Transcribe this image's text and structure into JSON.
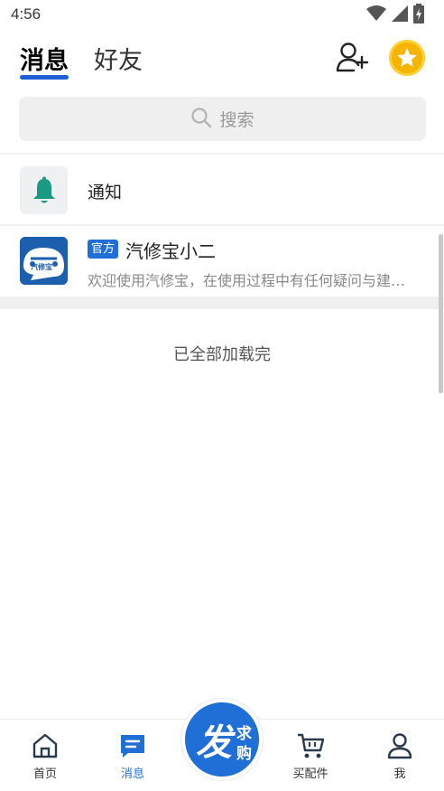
{
  "status_bar": {
    "time": "4:56",
    "icons": [
      "wifi-icon",
      "signal-icon",
      "battery-icon"
    ]
  },
  "header": {
    "tabs": [
      {
        "label": "消息",
        "active": true
      },
      {
        "label": "好友",
        "active": false
      }
    ],
    "icons": [
      "add-friend-icon",
      "coin-star-icon"
    ]
  },
  "search": {
    "placeholder": "搜索",
    "icon": "search-icon"
  },
  "notice": {
    "label": "通知",
    "icon": "bell-icon"
  },
  "chat_list": [
    {
      "badge": "官方",
      "name": "汽修宝小二",
      "preview": "欢迎使用汽修宝，在使用过程中有任何疑问与建…",
      "avatar_text": "汽修宝"
    }
  ],
  "footer_text": "已全部加载完",
  "bottom_nav": {
    "items": [
      {
        "label": "首页",
        "icon": "home-icon",
        "active": false
      },
      {
        "label": "消息",
        "icon": "message-icon",
        "active": true
      },
      {
        "label": "买配件",
        "icon": "cart-icon",
        "active": false
      },
      {
        "label": "我",
        "icon": "user-icon",
        "active": false
      }
    ],
    "post_button": {
      "main": "发",
      "sub": [
        "求",
        "购"
      ]
    }
  },
  "colors": {
    "accent": "#1f6fd6",
    "tab_underline": "#1f5fd6",
    "bell": "#1a9a82",
    "coin": "#f5b400"
  }
}
